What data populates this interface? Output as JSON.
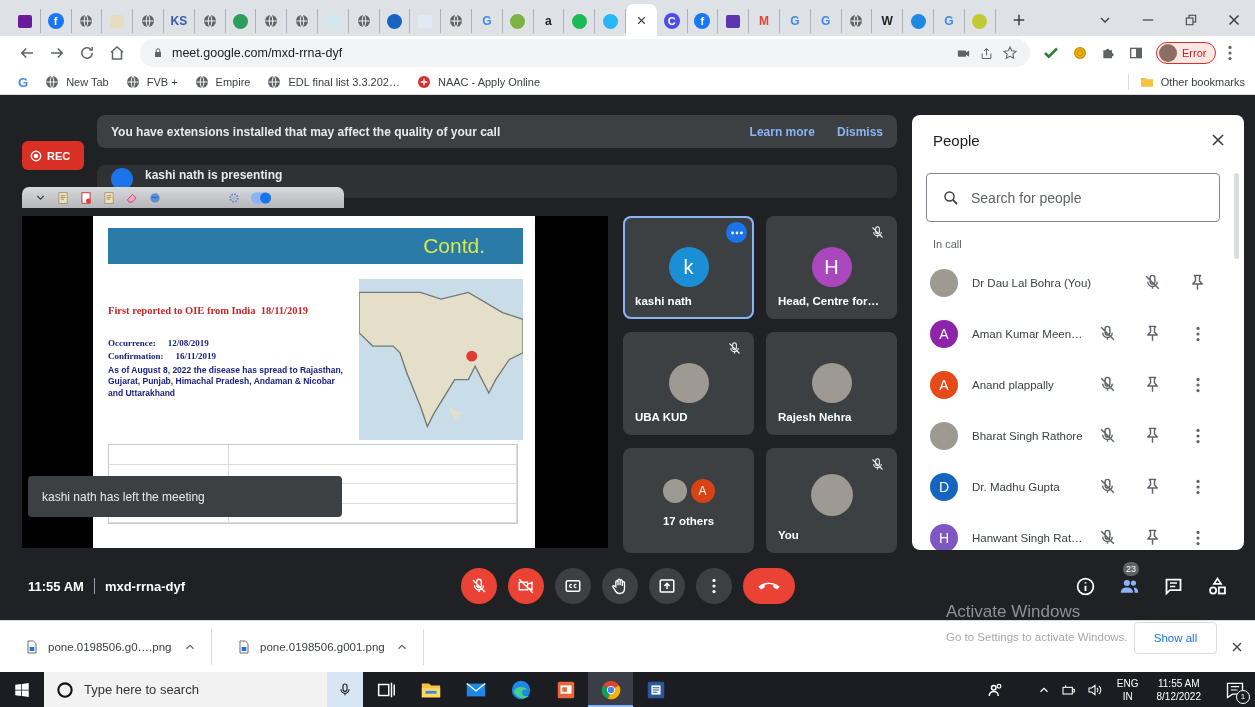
{
  "browser": {
    "tabs": [
      {
        "kind": "square",
        "color": "#6a1b9a",
        "selected": false
      },
      {
        "kind": "badge",
        "glyph": "f",
        "color": "#1877f2",
        "selected": false
      },
      {
        "kind": "globe",
        "selected": false
      },
      {
        "kind": "square",
        "color": "#e6dcc0",
        "selected": false
      },
      {
        "kind": "globe",
        "selected": false
      },
      {
        "kind": "letter",
        "glyph": "KS",
        "color": "#3a5ba9",
        "selected": false
      },
      {
        "kind": "globe",
        "selected": false
      },
      {
        "kind": "dot",
        "color": "#2e9e5b",
        "selected": false
      },
      {
        "kind": "globe",
        "selected": false
      },
      {
        "kind": "globe",
        "selected": false
      },
      {
        "kind": "dot",
        "color": "#cfe8f0",
        "selected": false
      },
      {
        "kind": "globe",
        "selected": false
      },
      {
        "kind": "dot",
        "color": "#1565c0",
        "selected": false
      },
      {
        "kind": "square",
        "color": "#dfeaf5",
        "selected": false
      },
      {
        "kind": "globe",
        "selected": false
      },
      {
        "kind": "letter",
        "glyph": "G",
        "color": "#4285f4",
        "selected": false
      },
      {
        "kind": "dot",
        "color": "#7cb342",
        "selected": false
      },
      {
        "kind": "letter",
        "glyph": "a",
        "color": "#222222",
        "selected": false
      },
      {
        "kind": "dot",
        "color": "#1db954",
        "selected": false
      },
      {
        "kind": "dot",
        "color": "#29b6f6",
        "selected": false
      },
      {
        "kind": "blank",
        "selected": true
      },
      {
        "kind": "badge",
        "glyph": "C",
        "color": "#4a4de8",
        "selected": false
      },
      {
        "kind": "badge",
        "glyph": "f",
        "color": "#1877f2",
        "selected": false
      },
      {
        "kind": "square",
        "color": "#5e35b1",
        "selected": false
      },
      {
        "kind": "letter",
        "glyph": "M",
        "color": "#ea4335",
        "selected": false
      },
      {
        "kind": "letter",
        "glyph": "G",
        "color": "#4285f4",
        "selected": false
      },
      {
        "kind": "letter",
        "glyph": "G",
        "color": "#4285f4",
        "selected": false
      },
      {
        "kind": "globe",
        "selected": false
      },
      {
        "kind": "letter",
        "glyph": "W",
        "color": "#222222",
        "selected": false
      },
      {
        "kind": "dot",
        "color": "#1e88e5",
        "selected": false
      },
      {
        "kind": "letter",
        "glyph": "G",
        "color": "#4285f4",
        "selected": false
      },
      {
        "kind": "dot",
        "color": "#c0ca33",
        "selected": false
      }
    ],
    "url": "meet.google.com/mxd-rrna-dyf",
    "profile_label": "Error",
    "bookmarks": [
      {
        "kind": "letter",
        "glyph": "G",
        "color": "#4285f4"
      },
      {
        "kind": "globe",
        "label": "New Tab"
      },
      {
        "kind": "globe",
        "label": "FVB +"
      },
      {
        "kind": "globe",
        "label": "Empire"
      },
      {
        "kind": "globe",
        "label": "EDL final list 3.3.202…"
      },
      {
        "kind": "site",
        "label": "NAAC - Apply Online",
        "color": "#d32f2f"
      }
    ],
    "other_bookmarks": "Other bookmarks"
  },
  "meet": {
    "notice": {
      "text": "You have extensions installed that may affect the quality of your call",
      "actions": [
        "Learn more",
        "Dismiss"
      ]
    },
    "recording_badge": "REC",
    "presenting_banner": "kashi nath is presenting",
    "slide": {
      "header": "Contd.",
      "title": "First reported to OIE from India  18/11/2019",
      "facts": [
        {
          "label": "Occurrence:",
          "value": "12/08/2019"
        },
        {
          "label": "Confirmation:",
          "value": "16/11/2019"
        }
      ],
      "summary": "As of August 8, 2022 the disease has spread to Rajasthan, Gujarat, Punjab, Himachal Pradesh, Andaman & Nicobar and Uttarakhand"
    },
    "toast": "kashi nath has left the meeting",
    "tiles": [
      {
        "kind": "participant",
        "name": "kashi nath",
        "avatar": {
          "kind": "letter",
          "letter": "k",
          "color": "#1a8fd6"
        },
        "highlighted": true,
        "muted": false
      },
      {
        "kind": "participant",
        "name": "Head, Centre for…",
        "avatar": {
          "kind": "letter",
          "letter": "H",
          "color": "#ab47bc"
        },
        "highlighted": false,
        "muted": true
      },
      {
        "kind": "participant",
        "name": "UBA KUD",
        "avatar": {
          "kind": "photo"
        },
        "highlighted": false,
        "muted": true
      },
      {
        "kind": "participant",
        "name": "Rajesh Nehra",
        "avatar": {
          "kind": "photo"
        },
        "highlighted": false,
        "muted": false
      },
      {
        "kind": "group",
        "name": "17 others",
        "avatars": [
          {
            "kind": "photo"
          },
          {
            "kind": "letter",
            "letter": "A",
            "color": "#d84315"
          }
        ],
        "highlighted": false,
        "muted": false
      },
      {
        "kind": "self",
        "name": "You",
        "avatar": {
          "kind": "photo"
        },
        "highlighted": false,
        "muted": true
      }
    ],
    "clock": "11:55 AM",
    "meeting_code": "mxd-rrna-dyf",
    "controls": [
      {
        "kind": "mic",
        "on": false
      },
      {
        "kind": "camera",
        "on": false
      },
      {
        "kind": "captions"
      },
      {
        "kind": "raise-hand"
      },
      {
        "kind": "present"
      },
      {
        "kind": "more"
      },
      {
        "kind": "leave"
      }
    ],
    "side_buttons": [
      {
        "kind": "info",
        "selected": false
      },
      {
        "kind": "people",
        "selected": true,
        "badge": "23"
      },
      {
        "kind": "chat",
        "selected": false
      },
      {
        "kind": "activities",
        "selected": false
      }
    ],
    "people_panel": {
      "title": "People",
      "search": {
        "placeholder": "Search for people"
      },
      "section": "In call",
      "people": [
        {
          "name": "Dr Dau Lal Bohra (You)",
          "avatar": {
            "kind": "photo"
          },
          "muted": true,
          "menu": false
        },
        {
          "name": "Aman Kumar Meen…",
          "avatar": {
            "kind": "letter",
            "letter": "A",
            "color": "#8e24aa"
          },
          "muted": true,
          "menu": true
        },
        {
          "name": "Anand plappally",
          "avatar": {
            "kind": "letter",
            "letter": "A",
            "color": "#e64a19"
          },
          "muted": true,
          "menu": true
        },
        {
          "name": "Bharat Singh Rathore",
          "avatar": {
            "kind": "photo"
          },
          "muted": true,
          "menu": true
        },
        {
          "name": "Dr. Madhu Gupta",
          "avatar": {
            "kind": "letter",
            "letter": "D",
            "color": "#1565c0"
          },
          "muted": true,
          "menu": true
        },
        {
          "name": "Hanwant Singh Rat…",
          "avatar": {
            "kind": "letter",
            "letter": "H",
            "color": "#7e57c2"
          },
          "muted": true,
          "menu": true
        }
      ]
    }
  },
  "downloads": {
    "items": [
      "pone.0198506.g0….png",
      "pone.0198506.g001.png"
    ],
    "show_all": "Show all"
  },
  "taskbar": {
    "search_placeholder": "Type here to search",
    "apps": [
      {
        "kind": "task-view",
        "selected": false
      },
      {
        "kind": "explorer",
        "selected": false
      },
      {
        "kind": "mail",
        "selected": false
      },
      {
        "kind": "edge",
        "selected": false
      },
      {
        "kind": "slides",
        "selected": false
      },
      {
        "kind": "chrome",
        "selected": true
      },
      {
        "kind": "word",
        "selected": false
      }
    ],
    "language": [
      "ENG",
      "IN"
    ],
    "time": "11:55 AM",
    "date": "8/12/2022",
    "notification_count": "1"
  },
  "activation_notice": {
    "title": "Activate Windows",
    "text": "Go to Settings to activate Windows."
  }
}
